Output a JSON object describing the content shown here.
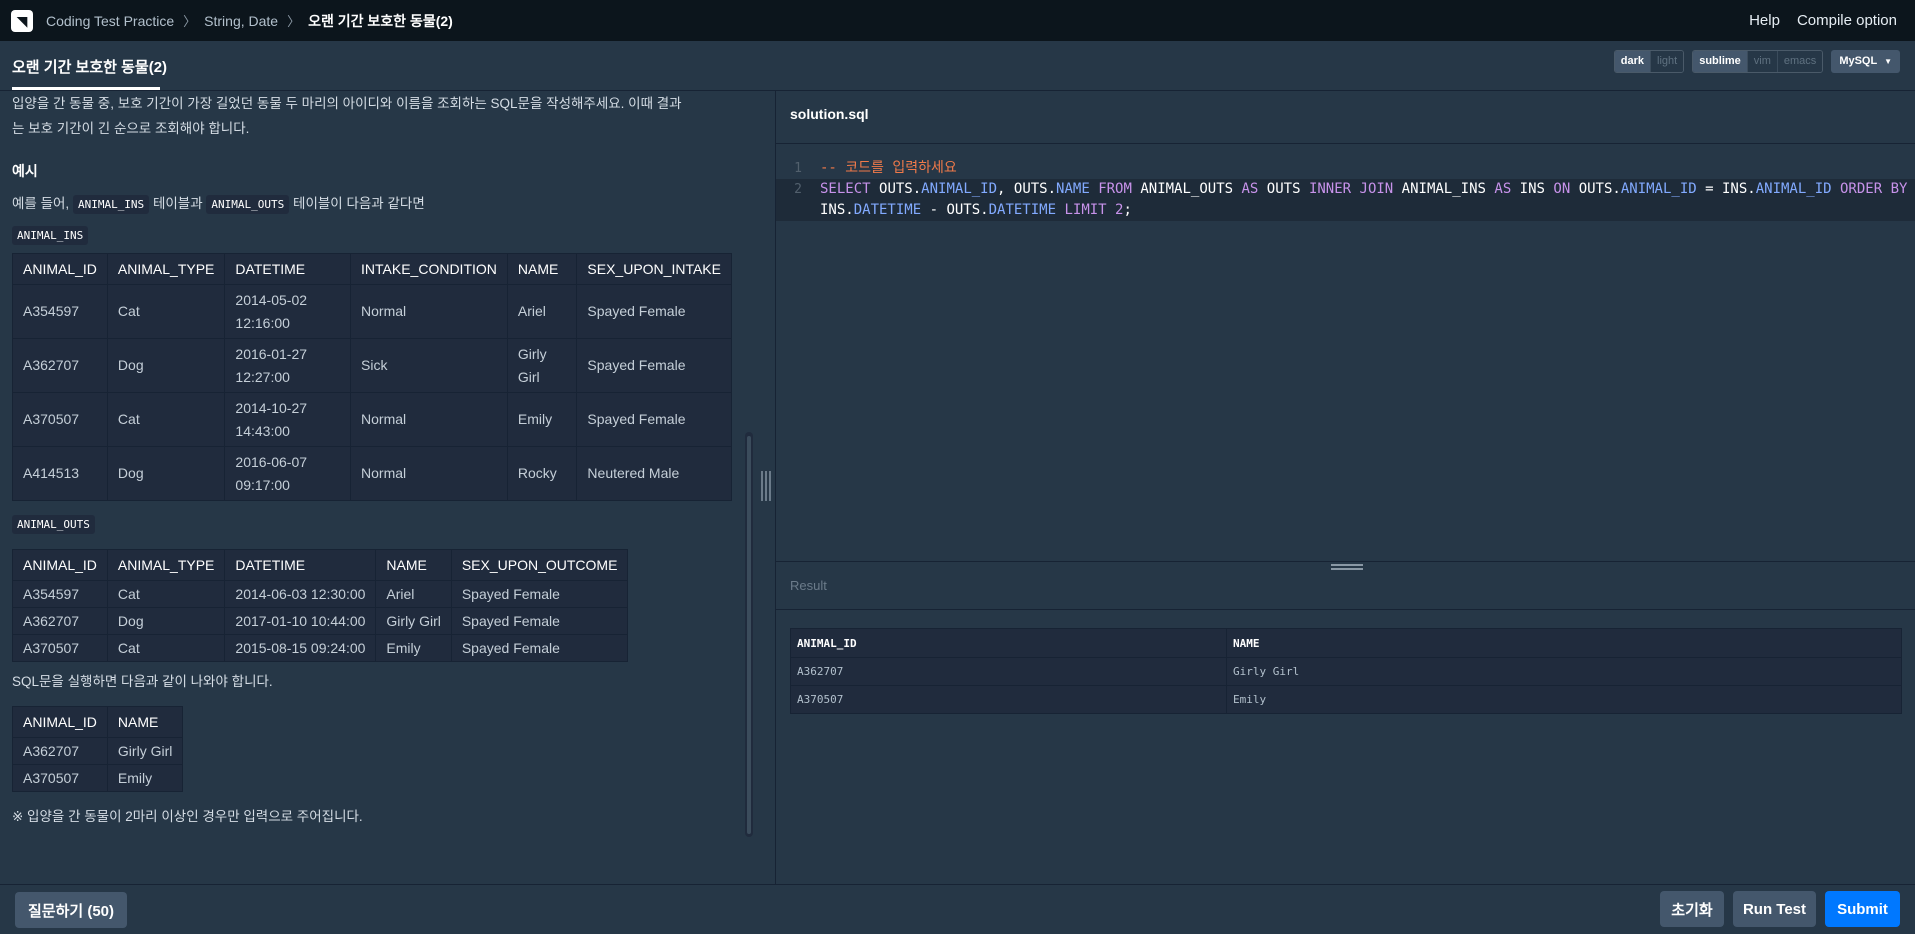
{
  "nav": {
    "logo": "◥",
    "crumbs": [
      "Coding Test Practice",
      "String, Date"
    ],
    "current": "오랜 기간 보호한 동물(2)",
    "help": "Help",
    "compile_option": "Compile option"
  },
  "lesson": {
    "title": "오랜 기간 보호한 동물(2)",
    "theme": [
      "dark",
      "light"
    ],
    "keymap": [
      "sublime",
      "vim",
      "emacs"
    ],
    "language": "MySQL"
  },
  "problem": {
    "intro_line1": "입양을 간 동물 중, 보호 기간이 가장 길었던 동물 두 마리의 아이디와 이름을 조회하는 SQL문을 작성해주세요. 이때 결과",
    "intro_line2": "는 보호 기간이 긴 순으로 조회해야 합니다.",
    "example_heading": "예시",
    "example_text_a": "예를 들어,",
    "example_code_a": "ANIMAL_INS",
    "example_text_b": "테이블과",
    "example_code_b": "ANIMAL_OUTS",
    "example_text_c": "테이블이 다음과 같다면",
    "ins_label": "ANIMAL_INS",
    "ins_headers": [
      "ANIMAL_ID",
      "ANIMAL_TYPE",
      "DATETIME",
      "INTAKE_CONDITION",
      "NAME",
      "SEX_UPON_INTAKE"
    ],
    "ins_rows": [
      [
        "A354597",
        "Cat",
        "2014-05-02 12:16:00",
        "Normal",
        "Ariel",
        "Spayed Female"
      ],
      [
        "A362707",
        "Dog",
        "2016-01-27 12:27:00",
        "Sick",
        "Girly Girl",
        "Spayed Female"
      ],
      [
        "A370507",
        "Cat",
        "2014-10-27 14:43:00",
        "Normal",
        "Emily",
        "Spayed Female"
      ],
      [
        "A414513",
        "Dog",
        "2016-06-07 09:17:00",
        "Normal",
        "Rocky",
        "Neutered Male"
      ]
    ],
    "outs_label": "ANIMAL_OUTS",
    "outs_headers": [
      "ANIMAL_ID",
      "ANIMAL_TYPE",
      "DATETIME",
      "NAME",
      "SEX_UPON_OUTCOME"
    ],
    "outs_rows": [
      [
        "A354597",
        "Cat",
        "2014-06-03 12:30:00",
        "Ariel",
        "Spayed Female"
      ],
      [
        "A362707",
        "Dog",
        "2017-01-10 10:44:00",
        "Girly Girl",
        "Spayed Female"
      ],
      [
        "A370507",
        "Cat",
        "2015-08-15 09:24:00",
        "Emily",
        "Spayed Female"
      ]
    ],
    "result_intro": "SQL문을 실행하면 다음과 같이 나와야 합니다.",
    "expected_headers": [
      "ANIMAL_ID",
      "NAME"
    ],
    "expected_rows": [
      [
        "A362707",
        "Girly Girl"
      ],
      [
        "A370507",
        "Emily"
      ]
    ],
    "note": "※ 입양을 간 동물이 2마리 이상인 경우만 입력으로 주어집니다."
  },
  "editor": {
    "filename": "solution.sql",
    "line_numbers": [
      "1",
      "2"
    ],
    "comment": "-- 코드를 입력하세요",
    "code_tokens": [
      [
        "kw",
        "SELECT "
      ],
      [
        "txt",
        "OUTS."
      ],
      [
        "prop",
        "ANIMAL_ID"
      ],
      [
        "txt",
        ", OUTS."
      ],
      [
        "prop",
        "NAME"
      ],
      [
        "kw",
        " FROM "
      ],
      [
        "txt",
        "ANIMAL_OUTS "
      ],
      [
        "kw",
        "AS"
      ],
      [
        "txt",
        " OUTS "
      ],
      [
        "kw",
        "INNER JOIN"
      ],
      [
        "txt",
        " ANIMAL_INS "
      ],
      [
        "kw",
        "AS"
      ],
      [
        "txt",
        " INS "
      ],
      [
        "kw",
        "ON"
      ],
      [
        "txt",
        " OUTS."
      ],
      [
        "prop",
        "ANIMAL_ID"
      ],
      [
        "txt",
        " = INS."
      ],
      [
        "prop",
        "ANIMAL_ID"
      ],
      [
        "kw",
        " ORDER BY"
      ],
      [
        "txt",
        " INS."
      ],
      [
        "prop",
        "DATETIME"
      ],
      [
        "txt",
        " - OUTS."
      ],
      [
        "prop",
        "DATETIME"
      ],
      [
        "kw",
        " LIMIT "
      ],
      [
        "num",
        "2"
      ],
      [
        "txt",
        ";"
      ]
    ]
  },
  "result": {
    "label": "Result",
    "headers": [
      "ANIMAL_ID",
      "NAME"
    ],
    "rows": [
      [
        "A362707",
        "Girly Girl"
      ],
      [
        "A370507",
        "Emily"
      ]
    ]
  },
  "footer": {
    "ask_label": "질문하기 (50)",
    "reset_label": "초기화",
    "run_label": "Run Test",
    "submit_label": "Submit"
  },
  "colors": {
    "background": "#263747",
    "nav": "#0c151c",
    "submit": "#0078ff",
    "keyword": "#c792ea",
    "property": "#82aaff",
    "comment": "#f07a4a"
  }
}
